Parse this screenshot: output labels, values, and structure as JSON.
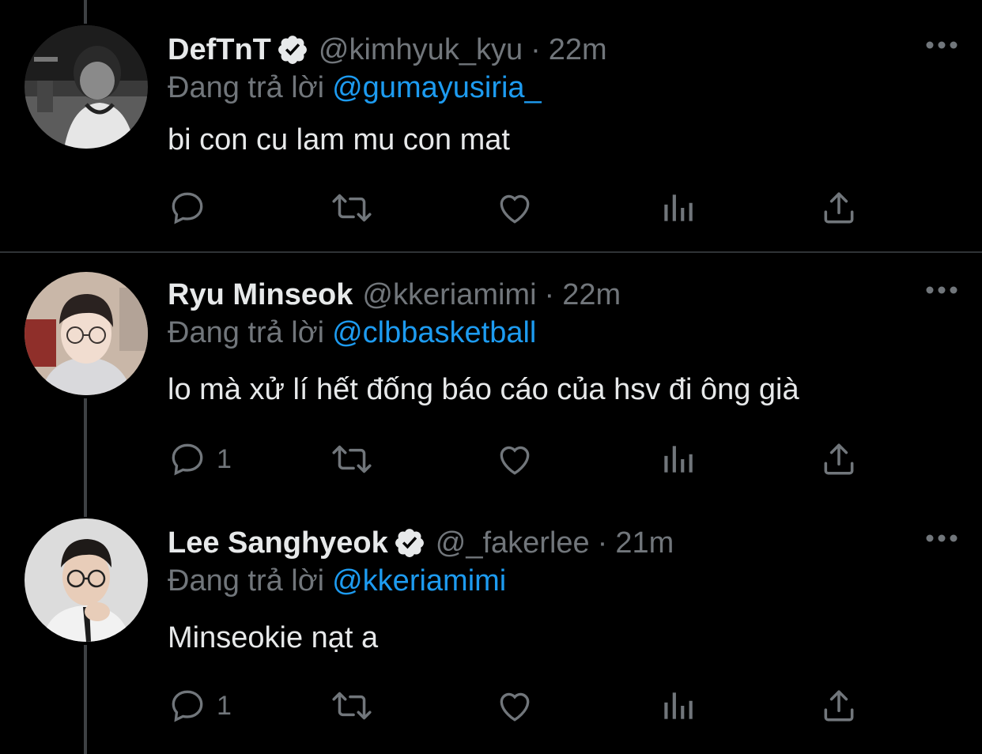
{
  "colors": {
    "background": "#000000",
    "primary_text": "#e7e9ea",
    "secondary_text": "#71767b",
    "link": "#1d9bf0",
    "divider": "#2f3336",
    "thread_line": "#3e4144"
  },
  "icons": {
    "more": "more-horizontal-icon",
    "reply": "speech-bubble-icon",
    "retweet": "retweet-arrows-icon",
    "like": "heart-icon",
    "views": "bar-chart-icon",
    "share": "share-upload-icon",
    "verified": "verified-badge-icon"
  },
  "tweets": [
    {
      "name": "DefTnT",
      "verified": true,
      "handle": "@kimhyuk_kyu",
      "separator": "·",
      "time": "22m",
      "reply_prefix": "Đang trả lời",
      "reply_to": "@gumayusiria_",
      "text": "bi con cu lam mu con mat",
      "reply_count": ""
    },
    {
      "name": "Ryu Minseok",
      "verified": false,
      "handle": "@kkeriamimi",
      "separator": "·",
      "time": "22m",
      "reply_prefix": "Đang trả lời",
      "reply_to": "@clbbasketball",
      "text": "lo mà xử lí hết đống báo cáo của hsv đi ông già",
      "reply_count": "1"
    },
    {
      "name": "Lee Sanghyeok",
      "verified": true,
      "handle": "@_fakerlee",
      "separator": "·",
      "time": "21m",
      "reply_prefix": "Đang trả lời",
      "reply_to": "@kkeriamimi",
      "text": "Minseokie nạt a",
      "reply_count": "1"
    }
  ]
}
